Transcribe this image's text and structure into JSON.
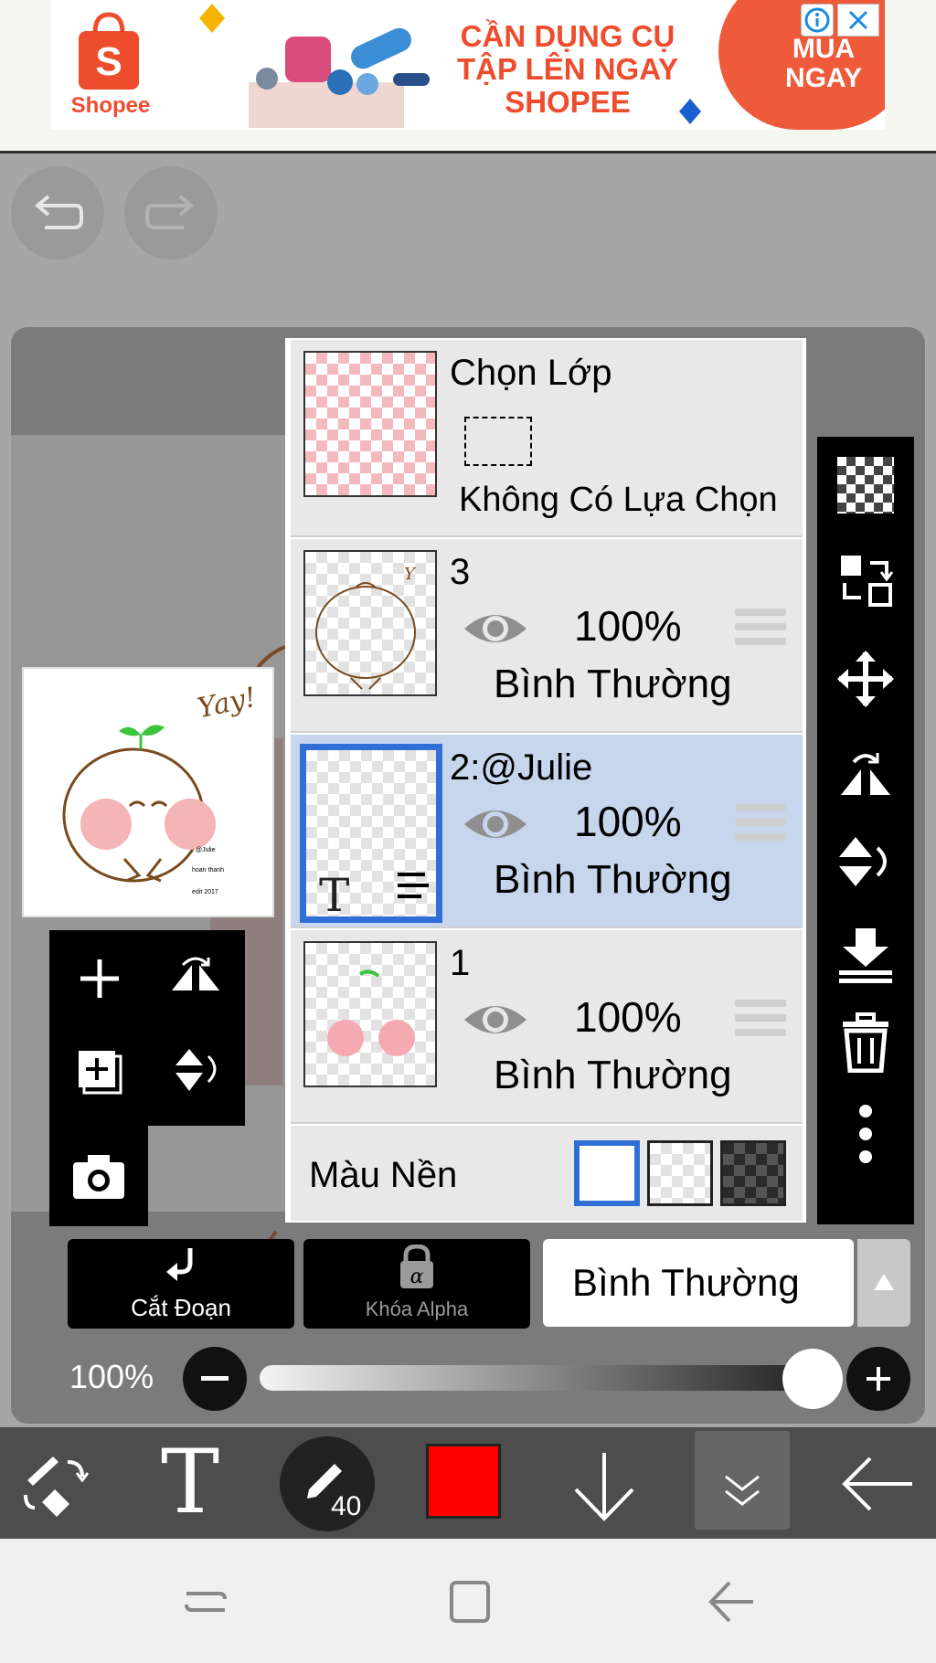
{
  "ad": {
    "brand": "Shopee",
    "headline": "CẦN DỤNG CỤ\nTẬP LÊN NGAY\nSHOPEE",
    "cta": "MUA\nNGAY",
    "accent": "#ee4d2d"
  },
  "layers_panel": {
    "selection_layer": {
      "title": "Chọn Lớp",
      "status": "Không Có Lựa Chọn"
    },
    "layers": [
      {
        "name": "3",
        "opacity": "100%",
        "blend": "Bình Thường",
        "selected": false
      },
      {
        "name": "2:@Julie",
        "opacity": "100%",
        "blend": "Bình Thường",
        "selected": true
      },
      {
        "name": "1",
        "opacity": "100%",
        "blend": "Bình Thường",
        "selected": false
      }
    ],
    "background": {
      "label": "Màu Nền"
    }
  },
  "preview": {
    "text": "Yay!"
  },
  "controls": {
    "clipping_label": "Cắt Đoạn",
    "alpha_lock_label": "Khóa Alpha",
    "blend_mode": "Bình Thường",
    "opacity_label": "100%",
    "opacity_value": 1.0
  },
  "toolbar": {
    "brush_size": "40",
    "color": "#ff0000"
  },
  "colors": {
    "selected_layer": "#c7d6ec",
    "selection_border": "#2f6fd6"
  }
}
